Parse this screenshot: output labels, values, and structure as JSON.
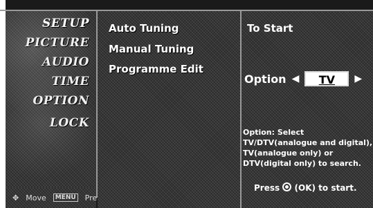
{
  "sidebar": {
    "items": [
      {
        "label": "SETUP"
      },
      {
        "label": "PICTURE"
      },
      {
        "label": "AUDIO"
      },
      {
        "label": "TIME"
      },
      {
        "label": "OPTION"
      },
      {
        "label": "LOCK"
      }
    ],
    "footer": {
      "move_label": "Move",
      "menu_badge": "MENU",
      "prev_label": "Prev"
    }
  },
  "submenu": {
    "items": [
      {
        "label": "Auto Tuning"
      },
      {
        "label": "Manual Tuning"
      },
      {
        "label": "Programme Edit"
      }
    ]
  },
  "panel": {
    "title": "To Start",
    "option_label": "Option",
    "option_value": "TV",
    "description": "Option: Select TV/DTV(analogue and digital), TV(analogue only) or DTV(digital only) to search.",
    "press_prefix": "Press",
    "press_suffix": "(OK) to start."
  }
}
